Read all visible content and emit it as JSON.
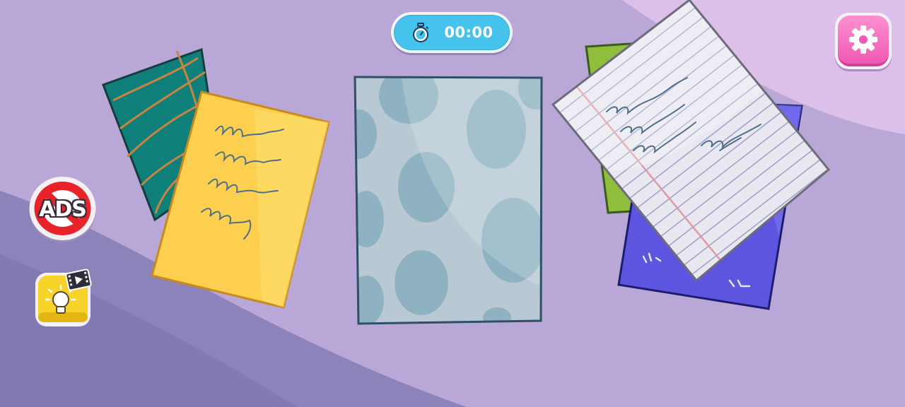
{
  "timer": {
    "text": "00:00",
    "icon": "stopwatch-icon"
  },
  "buttons": {
    "settings": {
      "icon": "gear-icon"
    },
    "remove_ads": {
      "label": "ADS",
      "icon": "no-ads-icon"
    },
    "hint": {
      "icon": "lightbulb-video-icon"
    }
  },
  "colors": {
    "background": "#b9a8d7",
    "background_light": "#dcc0ea",
    "background_dark": "#8b80b8",
    "timer": "#45c3ec",
    "settings": "#f277c2",
    "hint": "#f8d42a",
    "ads_ring": "#e8242a"
  },
  "cards": [
    {
      "name": "teal-card",
      "color": "#0f7f7a"
    },
    {
      "name": "yellow-card",
      "color": "#fcd04e"
    },
    {
      "name": "blue-grey-card",
      "color": "#b8c9d3"
    },
    {
      "name": "green-card",
      "color": "#8fbe3c"
    },
    {
      "name": "purple-card",
      "color": "#5d55e0"
    },
    {
      "name": "lined-paper-card",
      "color": "#e9e7ef"
    }
  ]
}
